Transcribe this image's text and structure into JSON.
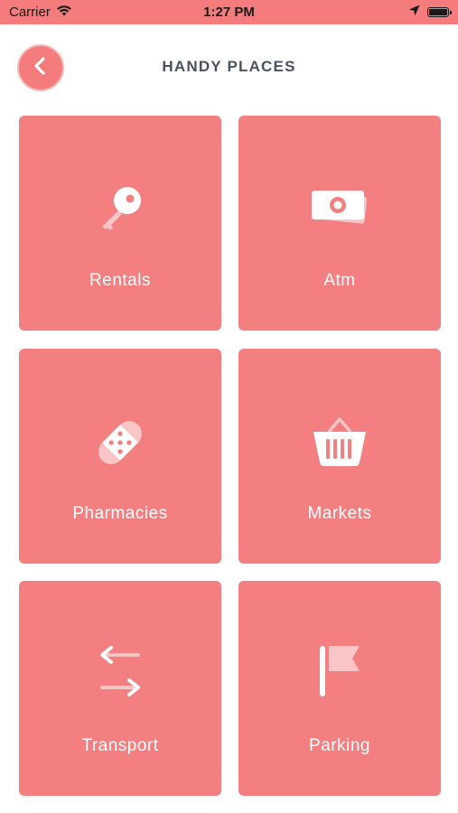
{
  "status_bar": {
    "carrier": "Carrier",
    "time": "1:27 PM",
    "icons": [
      "wifi-icon",
      "location-arrow-icon",
      "battery-icon"
    ]
  },
  "header": {
    "back_icon": "chevron-left-icon",
    "title": "HANDY PLACES"
  },
  "colors": {
    "accent": "#f47c7c",
    "tile": "#f47f80",
    "title_text": "#4a5160",
    "tile_text": "#ffffff"
  },
  "places": [
    {
      "label": "Rentals",
      "icon": "key-icon"
    },
    {
      "label": "Atm",
      "icon": "money-icon"
    },
    {
      "label": "Pharmacies",
      "icon": "bandage-icon"
    },
    {
      "label": "Markets",
      "icon": "basket-icon"
    },
    {
      "label": "Transport",
      "icon": "transfer-arrows-icon"
    },
    {
      "label": "Parking",
      "icon": "flag-icon"
    }
  ]
}
